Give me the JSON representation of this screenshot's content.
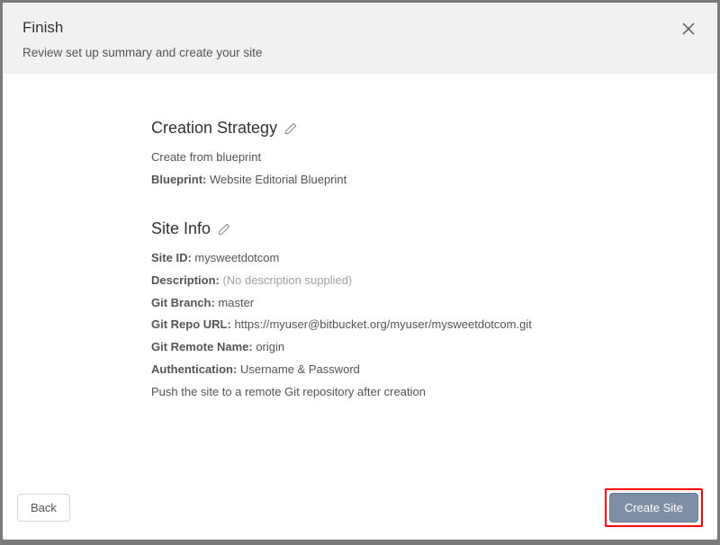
{
  "header": {
    "title": "Finish",
    "subtitle": "Review set up summary and create your site"
  },
  "strategy": {
    "heading": "Creation Strategy",
    "line1": "Create from blueprint",
    "blueprint_label": "Blueprint:",
    "blueprint_value": "Website Editorial Blueprint"
  },
  "siteinfo": {
    "heading": "Site Info",
    "siteid_label": "Site ID:",
    "siteid_value": "mysweetdotcom",
    "description_label": "Description:",
    "description_value": "(No description supplied)",
    "gitbranch_label": "Git Branch:",
    "gitbranch_value": "master",
    "gitrepo_label": "Git Repo URL:",
    "gitrepo_value": "https://myuser@bitbucket.org/myuser/mysweetdotcom.git",
    "gitremote_label": "Git Remote Name:",
    "gitremote_value": "origin",
    "auth_label": "Authentication:",
    "auth_value": "Username & Password",
    "push_note": "Push the site to a remote Git repository after creation"
  },
  "footer": {
    "back_label": "Back",
    "create_label": "Create Site"
  }
}
